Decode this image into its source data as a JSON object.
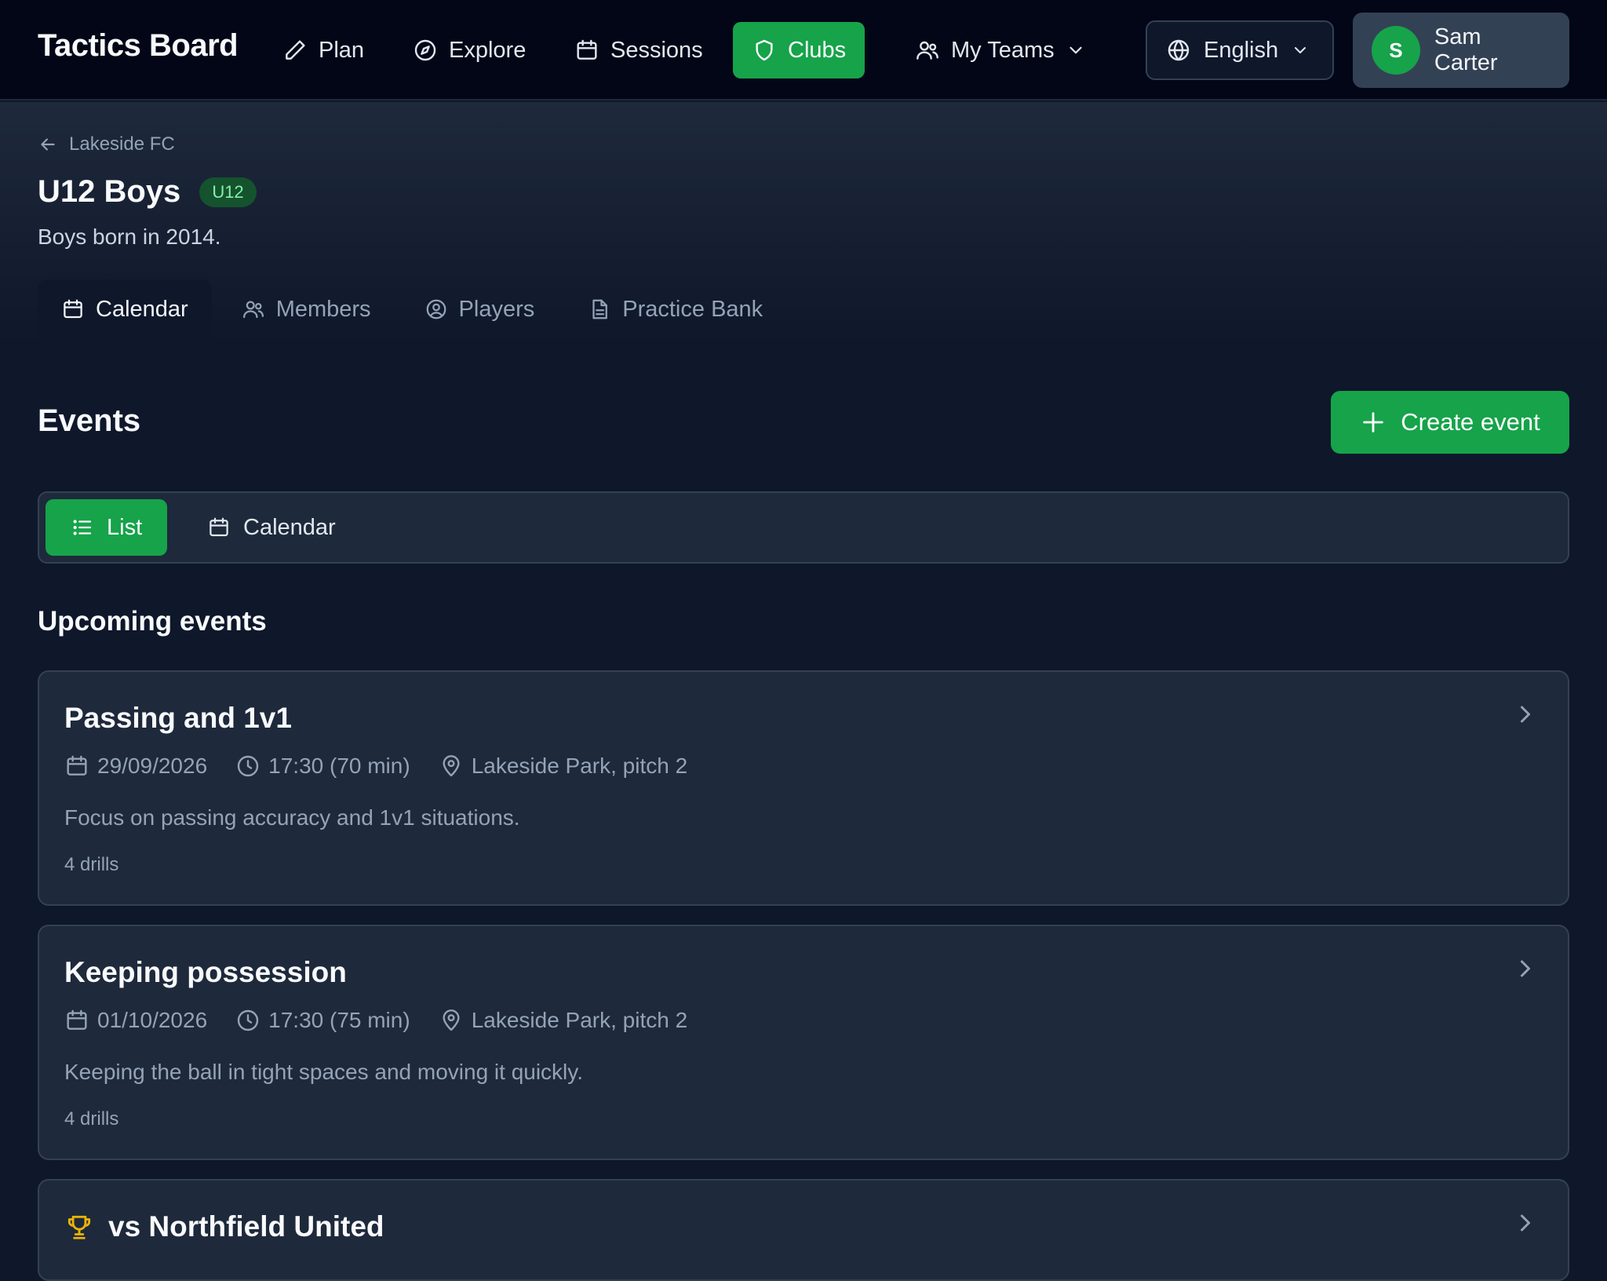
{
  "app": {
    "brand": "Tactics Board"
  },
  "nav": {
    "plan": "Plan",
    "explore": "Explore",
    "sessions": "Sessions",
    "clubs": "Clubs",
    "my_teams": "My Teams"
  },
  "language": {
    "selected": "English"
  },
  "user": {
    "initial": "S",
    "name": "Sam Carter"
  },
  "breadcrumb": {
    "parent": "Lakeside FC"
  },
  "team": {
    "name": "U12 Boys",
    "badge": "U12",
    "description": "Boys born in 2014."
  },
  "tabs": [
    {
      "label": "Calendar",
      "icon": "calendar-icon",
      "active": true
    },
    {
      "label": "Members",
      "icon": "users-icon",
      "active": false
    },
    {
      "label": "Players",
      "icon": "user-circle-icon",
      "active": false
    },
    {
      "label": "Practice Bank",
      "icon": "document-icon",
      "active": false
    }
  ],
  "events": {
    "title": "Events",
    "create_label": "Create event",
    "view_list": "List",
    "view_calendar": "Calendar",
    "upcoming_title": "Upcoming events",
    "items": [
      {
        "title": "Passing and 1v1",
        "date": "29/09/2026",
        "time": "17:30 (70 min)",
        "location": "Lakeside Park, pitch 2",
        "description": "Focus on passing accuracy and 1v1 situations.",
        "drills": "4 drills"
      },
      {
        "title": "Keeping possession",
        "date": "01/10/2026",
        "time": "17:30 (75 min)",
        "location": "Lakeside Park, pitch 2",
        "description": "Keeping the ball in tight spaces and moving it quickly.",
        "drills": "4 drills"
      },
      {
        "title": "vs Northfield United",
        "icon": "trophy-icon"
      }
    ]
  },
  "colors": {
    "accent": "#16a34a",
    "background": "#0f172a",
    "card": "#1e293b",
    "trophy": "#eab308"
  }
}
